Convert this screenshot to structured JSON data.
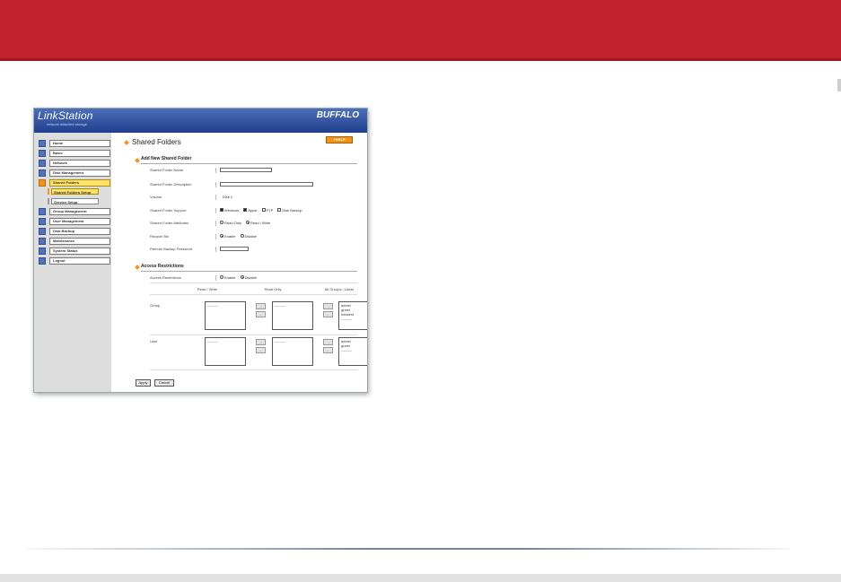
{
  "ui": {
    "header": {
      "logo": "LinkStation",
      "logo_sub": "network attached storage",
      "brand": "BUFFALO"
    },
    "sidebar": {
      "items": [
        {
          "label": "Home"
        },
        {
          "label": "Basic"
        },
        {
          "label": "Network"
        },
        {
          "label": "Disk Management"
        },
        {
          "label": "Shared Folders",
          "active": true
        },
        {
          "label": "Group Management"
        },
        {
          "label": "User Management"
        },
        {
          "label": "Disk Backup"
        },
        {
          "label": "Maintenance"
        },
        {
          "label": "System Status"
        },
        {
          "label": "Logout"
        }
      ],
      "subitems": [
        {
          "label": "Shared Folders Setup",
          "active": true
        },
        {
          "label": "Service Setup"
        }
      ]
    },
    "main": {
      "title": "Shared Folders",
      "help_label": "?HELP",
      "add_section": "Add New Shared Folder",
      "fields": {
        "name_label": "Shared Folder Name",
        "desc_label": "Shared Folder Description",
        "volume_label": "Volume",
        "volume_value": "Disk 1",
        "support_label": "Shared Folder Support",
        "support_options": [
          "Windows",
          "Apple",
          "FTP",
          "Disk Backup"
        ],
        "attr_label": "Shared Folder Attributes",
        "attr_options": [
          "Read Only",
          "Read / Write"
        ],
        "recycle_label": "Recycle Bin",
        "recycle_options": [
          "Enable",
          "Disable"
        ],
        "backup_pw_label": "Remote Backup Password"
      },
      "access_section": "Access Restrictions",
      "access": {
        "label": "Access Restrictions",
        "options": [
          "Enable",
          "Disable"
        ],
        "col_rw": "Read / Write",
        "col_ro": "Read Only",
        "col_all": "All Groups / Users",
        "group_label": "Group",
        "user_label": "User",
        "group_list": [
          "admin",
          "guest",
          "hdusers",
          "---------"
        ],
        "user_list": [
          "admin",
          "guest",
          "---------"
        ],
        "empty_list": "---------",
        "arrow_right": "→",
        "arrow_left": "←"
      },
      "apply_label": "Apply",
      "cancel_label": "Cancel"
    }
  }
}
